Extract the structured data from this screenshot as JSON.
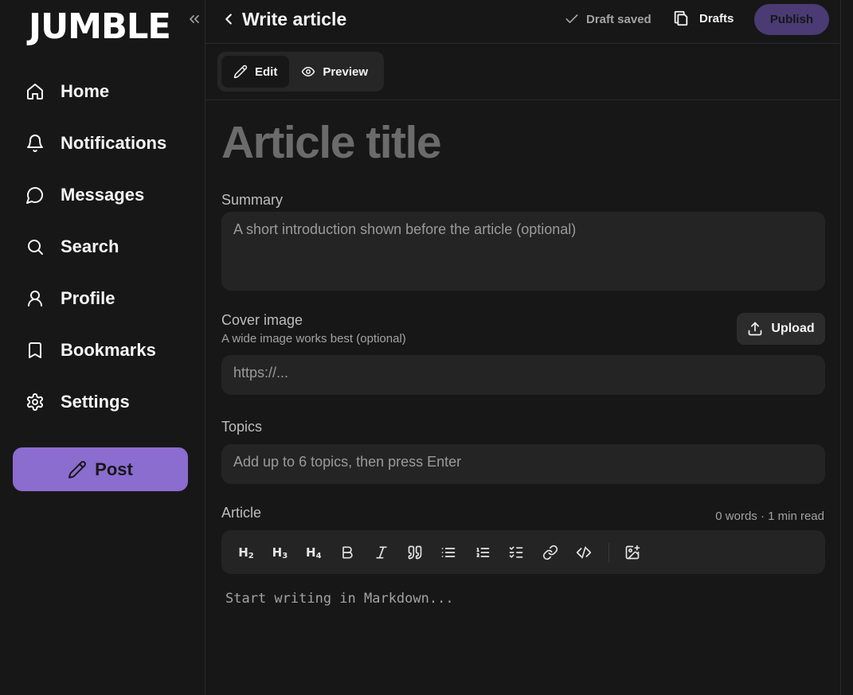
{
  "app": {
    "logo": "JUMBLE"
  },
  "sidebar": {
    "items": [
      {
        "label": "Home",
        "icon": "home-icon"
      },
      {
        "label": "Notifications",
        "icon": "bell-icon"
      },
      {
        "label": "Messages",
        "icon": "message-icon"
      },
      {
        "label": "Search",
        "icon": "search-icon"
      },
      {
        "label": "Profile",
        "icon": "user-icon"
      },
      {
        "label": "Bookmarks",
        "icon": "bookmark-icon"
      },
      {
        "label": "Settings",
        "icon": "gear-icon"
      }
    ],
    "post_label": "Post"
  },
  "header": {
    "title": "Write article",
    "draft_status": "Draft saved",
    "drafts_label": "Drafts",
    "publish_label": "Publish"
  },
  "mode_tabs": [
    {
      "label": "Edit",
      "active": true
    },
    {
      "label": "Preview",
      "active": false
    }
  ],
  "form": {
    "title_placeholder": "Article title",
    "summary_label": "Summary",
    "summary_placeholder": "A short introduction shown before the article (optional)",
    "cover_label": "Cover image",
    "cover_hint": "A wide image works best (optional)",
    "cover_placeholder": "https://...",
    "upload_label": "Upload",
    "topics_label": "Topics",
    "topics_placeholder": "Add up to 6 topics, then press Enter",
    "article_label": "Article",
    "word_count": "0 words · 1 min read",
    "editor_placeholder": "Start writing in Markdown..."
  },
  "toolbar": {
    "h2": "H",
    "h2_sub": "2",
    "h3": "H",
    "h3_sub": "3",
    "h4": "H",
    "h4_sub": "4"
  },
  "colors": {
    "background": "#171717",
    "accent": "#8b6ccf",
    "publish_disabled": "#4a3b74",
    "input_bg": "#242424"
  }
}
